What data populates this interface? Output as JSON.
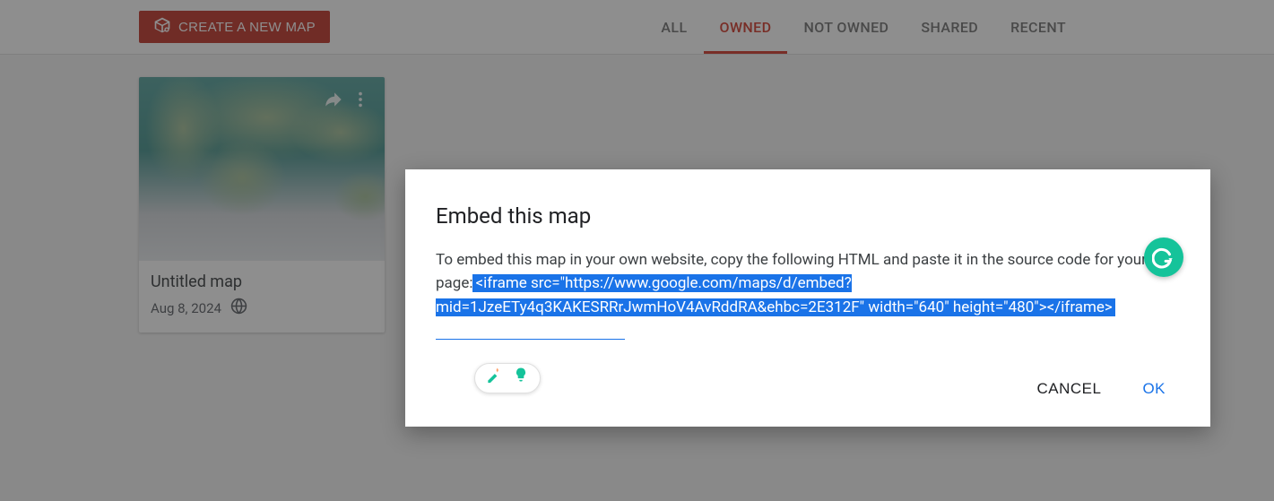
{
  "header": {
    "create_button": "CREATE A NEW MAP",
    "tabs": [
      {
        "label": "ALL",
        "active": false
      },
      {
        "label": "OWNED",
        "active": true
      },
      {
        "label": "NOT OWNED",
        "active": false
      },
      {
        "label": "SHARED",
        "active": false
      },
      {
        "label": "RECENT",
        "active": false
      }
    ]
  },
  "maps": [
    {
      "title": "Untitled map",
      "date": "Aug 8, 2024"
    }
  ],
  "dialog": {
    "title": "Embed this map",
    "body_prefix": "To embed this map in your own website, copy the following HTML and paste it in the source code for your page:",
    "embed_code": "<iframe src=\"https://www.google.com/maps/d/embed?mid=1JzeETy4q3KAKESRRrJwmHoV4AvRddRA&ehbc=2E312F\" width=\"640\" height=\"480\"></iframe>",
    "cancel": "CANCEL",
    "ok": "OK"
  }
}
